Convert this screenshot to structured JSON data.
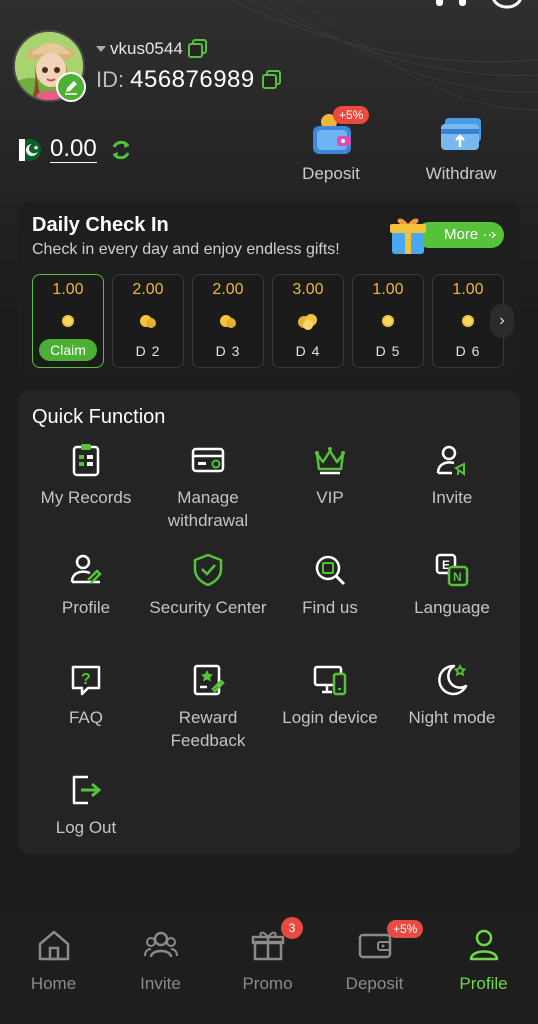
{
  "header": {
    "username": "vkus0544",
    "id_label": "ID:",
    "id_value": "456876989",
    "balance": "0.00"
  },
  "wallet": {
    "deposit_label": "Deposit",
    "deposit_badge": "+5%",
    "withdraw_label": "Withdraw"
  },
  "checkin": {
    "title": "Daily Check In",
    "subtitle": "Check in every day and enjoy endless gifts!",
    "more_label": "More ···",
    "days": [
      {
        "amount": "1.00",
        "label": "Claim"
      },
      {
        "amount": "2.00",
        "label": "D 2"
      },
      {
        "amount": "2.00",
        "label": "D 3"
      },
      {
        "amount": "3.00",
        "label": "D 4"
      },
      {
        "amount": "1.00",
        "label": "D 5"
      },
      {
        "amount": "1.00",
        "label": "D 6"
      }
    ]
  },
  "quick": {
    "title": "Quick Function",
    "items": [
      {
        "label": "My Records",
        "icon": "records-icon"
      },
      {
        "label": "Manage withdrawal",
        "icon": "card-icon"
      },
      {
        "label": "VIP",
        "icon": "crown-icon"
      },
      {
        "label": "Invite",
        "icon": "invite-user-icon"
      },
      {
        "label": "Profile",
        "icon": "profile-edit-icon"
      },
      {
        "label": "Security Center",
        "icon": "shield-icon"
      },
      {
        "label": "Find us",
        "icon": "search-icon"
      },
      {
        "label": "Language",
        "icon": "language-icon"
      },
      {
        "label": "FAQ",
        "icon": "question-icon"
      },
      {
        "label": "Reward Feedback",
        "icon": "feedback-icon"
      },
      {
        "label": "Login device",
        "icon": "device-icon"
      },
      {
        "label": "Night mode",
        "icon": "moon-icon"
      },
      {
        "label": "Log Out",
        "icon": "logout-icon"
      }
    ]
  },
  "nav": {
    "items": [
      {
        "label": "Home",
        "icon": "home-icon"
      },
      {
        "label": "Invite",
        "icon": "invite-icon"
      },
      {
        "label": "Promo",
        "icon": "gift-icon",
        "badge": "3"
      },
      {
        "label": "Deposit",
        "icon": "wallet-icon",
        "badge": "+5%"
      },
      {
        "label": "Profile",
        "icon": "profile-icon",
        "active": true
      }
    ]
  },
  "colors": {
    "accent": "#56c23a",
    "coin": "#f2b636",
    "badge": "#ea4a3f",
    "background": "#1c1c1c"
  }
}
